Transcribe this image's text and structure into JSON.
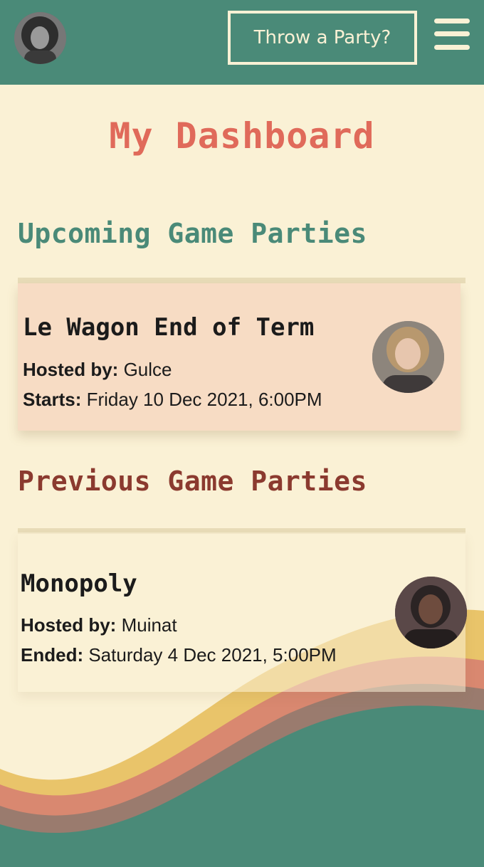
{
  "navbar": {
    "cta_label": "Throw a Party?"
  },
  "page": {
    "title": "My Dashboard"
  },
  "upcoming": {
    "heading": "Upcoming Game Parties",
    "parties": [
      {
        "name": "Le Wagon End of Term",
        "host_label": "Hosted by:",
        "host": "Gulce",
        "time_label": "Starts:",
        "time": "Friday 10 Dec 2021, 6:00PM"
      }
    ]
  },
  "previous": {
    "heading": "Previous Game Parties",
    "parties": [
      {
        "name": "Monopoly",
        "host_label": "Hosted by:",
        "host": "Muinat",
        "time_label": "Ended:",
        "time": "Saturday 4 Dec 2021, 5:00PM"
      }
    ]
  },
  "colors": {
    "navbar": "#4a8a78",
    "background": "#faf1d5",
    "title": "#e06a5a",
    "upcoming_heading": "#4a8a78",
    "previous_heading": "#8b3a2f",
    "upcoming_card": "#f7dcc4",
    "wave_yellow": "#e9c46a",
    "wave_orange": "#d98870",
    "wave_mauve": "#9a7b6e",
    "wave_teal": "#4a8a78"
  }
}
